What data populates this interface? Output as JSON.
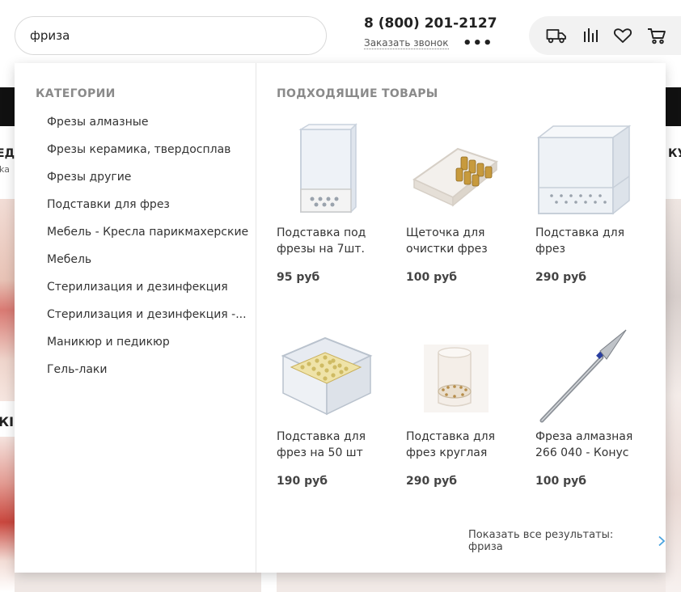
{
  "search": {
    "value": "фриза"
  },
  "header": {
    "phone": "8 (800) 201-2127",
    "callback_label": "Заказать звонок",
    "more_label": "•••",
    "icons": [
      "delivery-truck-icon",
      "compare-bars-icon",
      "heart-icon",
      "cart-icon"
    ]
  },
  "background": {
    "nav_left": "ЕДО",
    "nav_left_sub": "ika",
    "nav_right": "КУ",
    "promo_left": "КІ"
  },
  "dropdown": {
    "categories_title": "КАТЕГОРИИ",
    "products_title": "ПОДХОДЯЩИЕ ТОВАРЫ",
    "categories": [
      "Фрезы алмазные",
      "Фрезы керамика, твердосплав",
      "Фрезы другие",
      "Подставки для фрез",
      "Мебель - Кресла парикмахерские",
      "Мебель",
      "Стерилизация и дезинфекция",
      "Стерилизация и дезинфекция -...",
      "Маникюр и педикюр",
      "Гель-лаки"
    ],
    "products": [
      {
        "name": "Подставка под фрезы на 7шт.",
        "price": "95 руб",
        "image": "clear-stand-7-icon"
      },
      {
        "name": "Щеточка для очистки фрез",
        "price": "100 руб",
        "image": "cleaning-brush-icon"
      },
      {
        "name": "Подставка для фрез",
        "price": "290 руб",
        "image": "clear-stand-box-icon"
      },
      {
        "name": "Подставка для фрез на 50 шт",
        "price": "190 руб",
        "image": "stand-50-icon"
      },
      {
        "name": "Подставка для фрез круглая",
        "price": "290 руб",
        "image": "round-stand-icon"
      },
      {
        "name": "Фреза алмазная 266 040 - Конус",
        "price": "100 руб",
        "image": "diamond-bit-cone-icon"
      }
    ],
    "show_all_label": "Показать все результаты: фриза"
  },
  "colors": {
    "accent_link": "#4aa3df",
    "section_title": "#8a8a8a",
    "black_bar": "#111111"
  }
}
